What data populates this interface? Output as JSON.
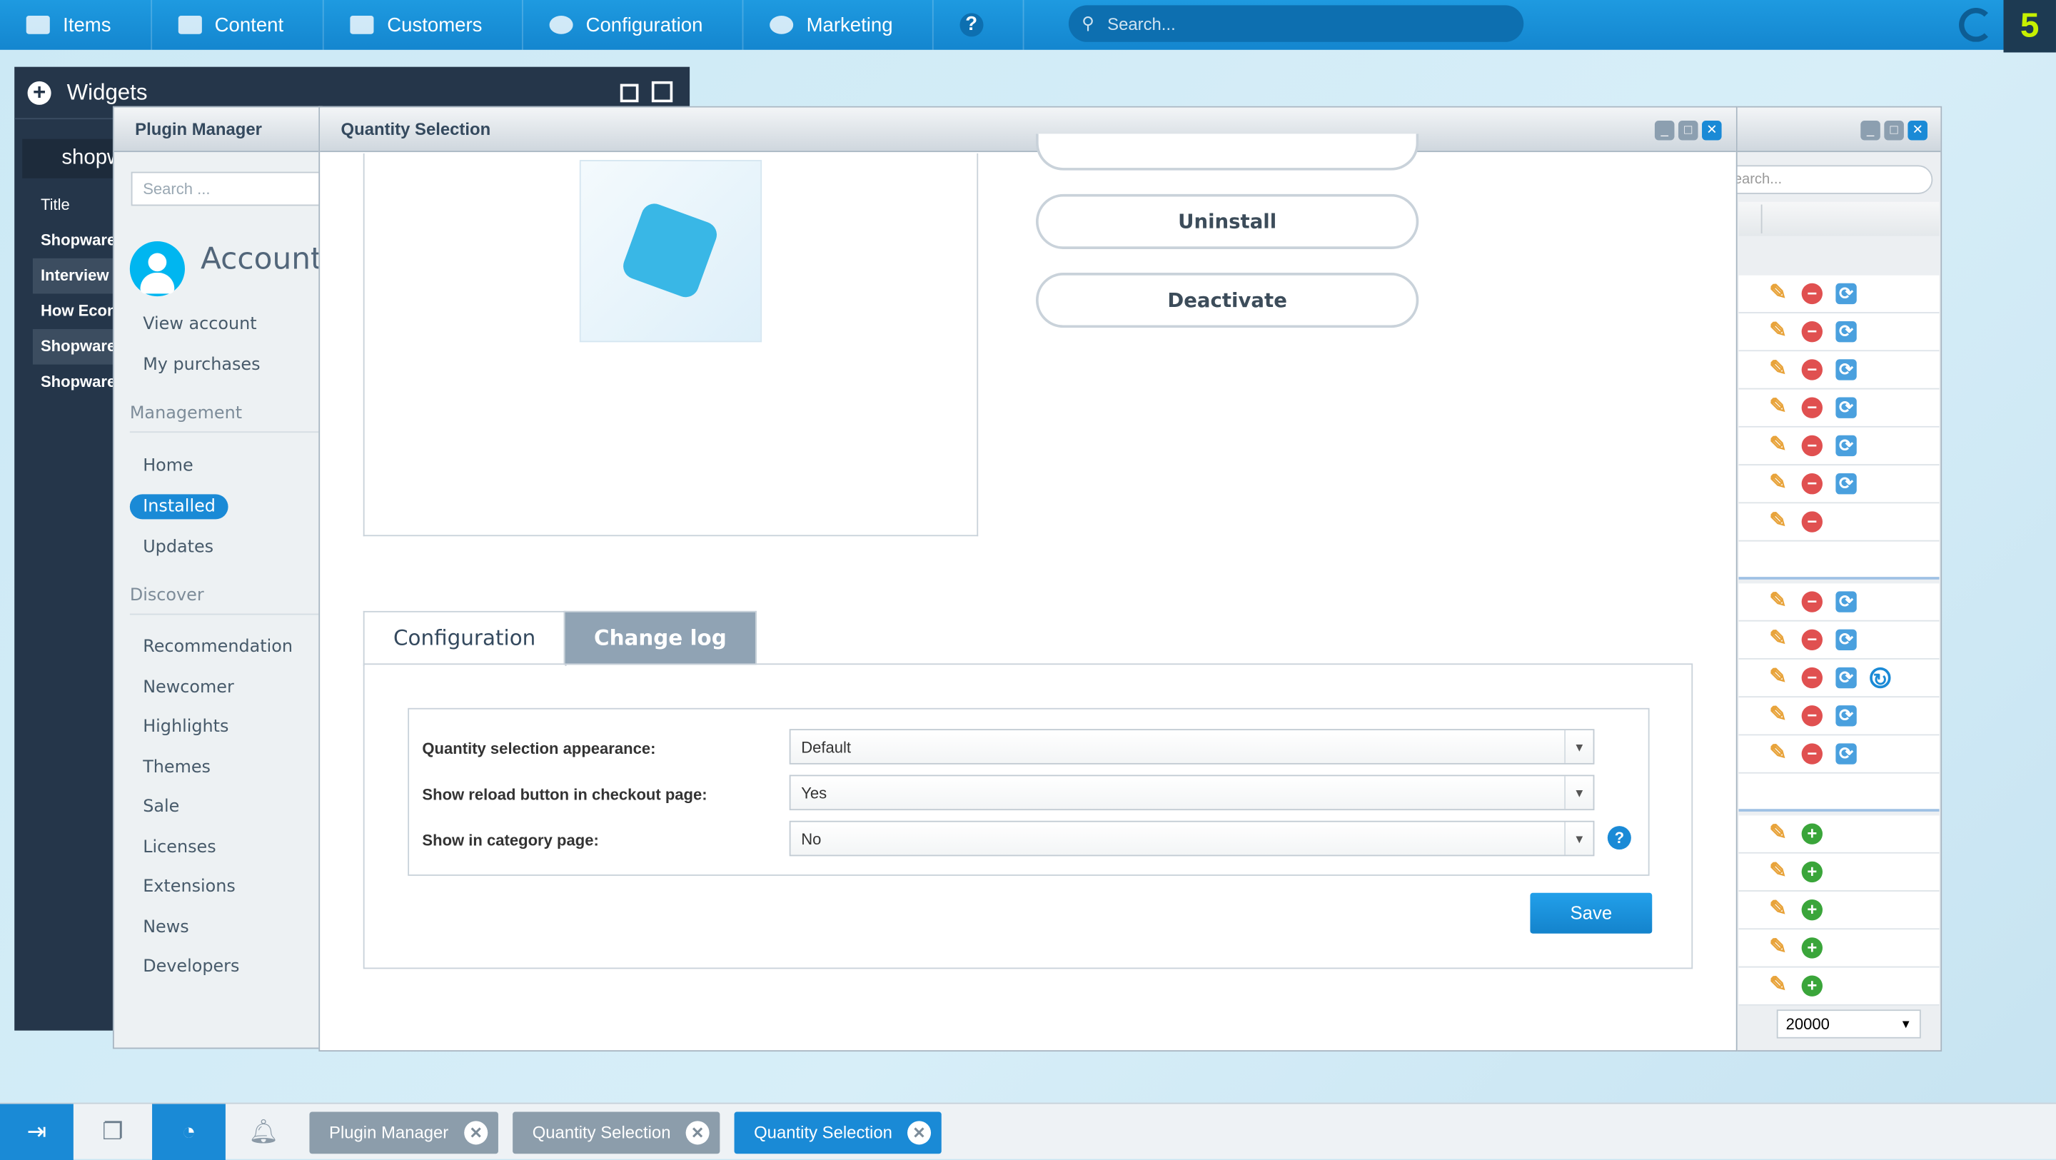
{
  "topbar": {
    "items": [
      "Items",
      "Content",
      "Customers",
      "Configuration",
      "Marketing"
    ],
    "help": "?",
    "search_placeholder": "Search...",
    "logo": "5"
  },
  "widgets": {
    "title": "Widgets",
    "shop": "shopware",
    "rows": [
      "Title",
      "Shopware",
      "Interview",
      "How Econ",
      "Shopware",
      "Shopware"
    ]
  },
  "plugin_manager": {
    "title": "Plugin Manager",
    "search_placeholder": "Search ...",
    "account": "Account",
    "account_links": [
      "View account",
      "My purchases"
    ],
    "management_heading": "Management",
    "management": [
      "Home",
      "Installed",
      "Updates"
    ],
    "active": "Installed",
    "discover_heading": "Discover",
    "discover": [
      "Recommendation",
      "Newcomer",
      "Highlights",
      "Themes",
      "Sale",
      "Licenses",
      "Extensions",
      "News",
      "Developers"
    ]
  },
  "quantity_selection": {
    "title": "Quantity Selection",
    "uninstall": "Uninstall",
    "deactivate": "Deactivate",
    "tabs": [
      "Configuration",
      "Change log"
    ],
    "active_tab": "Configuration",
    "fields": [
      {
        "label": "Quantity selection appearance:",
        "value": "Default"
      },
      {
        "label": "Show reload button in checkout page:",
        "value": "Yes"
      },
      {
        "label": "Show in category page:",
        "value": "No",
        "help": "?"
      }
    ],
    "save": "Save"
  },
  "background_window": {
    "search_placeholder": "Search...",
    "page_size": "20000",
    "groups": [
      [
        "edit-delete-update",
        "edit-delete-update",
        "edit-delete-update",
        "edit-delete-update",
        "edit-delete-update",
        "edit-delete-update",
        "edit-delete"
      ],
      [
        "edit-delete-update",
        "edit-delete-update",
        "edit-delete-update-refresh",
        "edit-delete-update",
        "edit-delete-update"
      ],
      [
        "edit-install",
        "edit-install",
        "edit-install",
        "edit-install",
        "edit-install"
      ]
    ]
  },
  "taskbar": {
    "tabs": [
      {
        "label": "Plugin Manager",
        "active": false
      },
      {
        "label": "Quantity Selection",
        "active": false
      },
      {
        "label": "Quantity Selection",
        "active": true
      }
    ]
  },
  "colors": {
    "accent": "#1486cf",
    "dark": "#25364a",
    "active_task": "#1a8ad6"
  }
}
